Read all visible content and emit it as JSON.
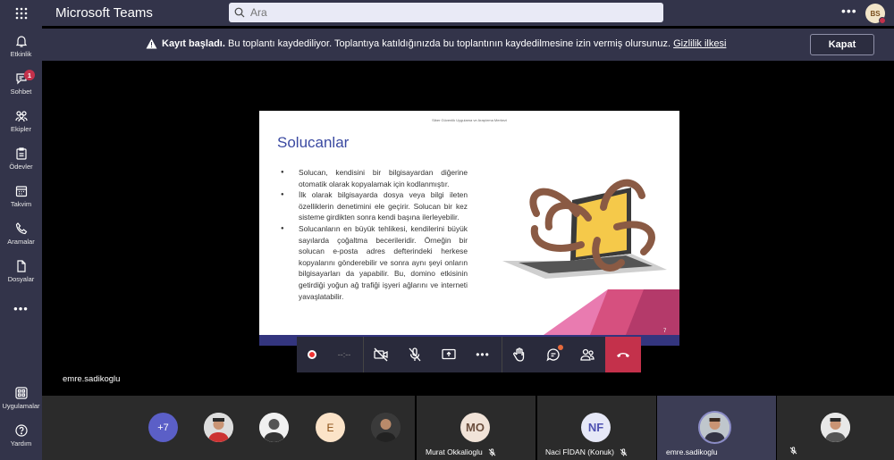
{
  "app": {
    "title": "Microsoft Teams"
  },
  "search": {
    "placeholder": "Ara"
  },
  "user": {
    "initials": "BS"
  },
  "rail": {
    "items": [
      {
        "label": "Etkinlik"
      },
      {
        "label": "Sohbet",
        "badge": "1"
      },
      {
        "label": "Ekipler"
      },
      {
        "label": "Ödevler"
      },
      {
        "label": "Takvim"
      },
      {
        "label": "Aramalar"
      },
      {
        "label": "Dosyalar"
      }
    ],
    "apps_label": "Uygulamalar",
    "help_label": "Yardım"
  },
  "banner": {
    "bold": "Kayıt başladı.",
    "text": " Bu toplantı kaydediliyor. Toplantıya katıldığınızda bu toplantının kaydedilmesine izin vermiş olursunuz. ",
    "link": "Gizlilik ilkesi",
    "close_label": "Kapat"
  },
  "slide": {
    "header": "Siber Güvenlik Uygulama ve Araştırma Merkezi",
    "title": "Solucanlar",
    "bullets": [
      "Solucan, kendisini bir bilgisayardan diğerine otomatik olarak kopyalamak için kodlanmıştır.",
      "İlk olarak bilgisayarda dosya veya bilgi ileten özelliklerin denetimini ele geçirir. Solucan bir kez sisteme girdikten sonra kendi başına ilerleyebilir.",
      "Solucanların en büyük tehlikesi, kendilerini büyük sayılarda çoğaltma becerileridir. Örneğin bir solucan e-posta adres defterindeki herkese kopyalarını gönderebilir ve sonra aynı şeyi onların bilgisayarları da yapabilir. Bu, domino etkisinin getirdiği yoğun ağ trafiği işyeri ağlarını ve interneti yavaşlatabilir."
    ],
    "page_number": "7"
  },
  "controls": {
    "timer": "--:--"
  },
  "self_name": "emre.sadikoglu",
  "participants": {
    "overflow": "+7",
    "e_initial": "E",
    "tiles": [
      {
        "initials": "MO",
        "name": "Murat Okkalioglu"
      },
      {
        "initials": "NF",
        "name": "Naci FİDAN (Konuk)"
      },
      {
        "name": "emre.sadikoglu"
      }
    ]
  },
  "colors": {
    "chrome": "#33344a",
    "accent": "#6264a7",
    "leave": "#c4314b",
    "slide_title": "#3a49a1"
  }
}
